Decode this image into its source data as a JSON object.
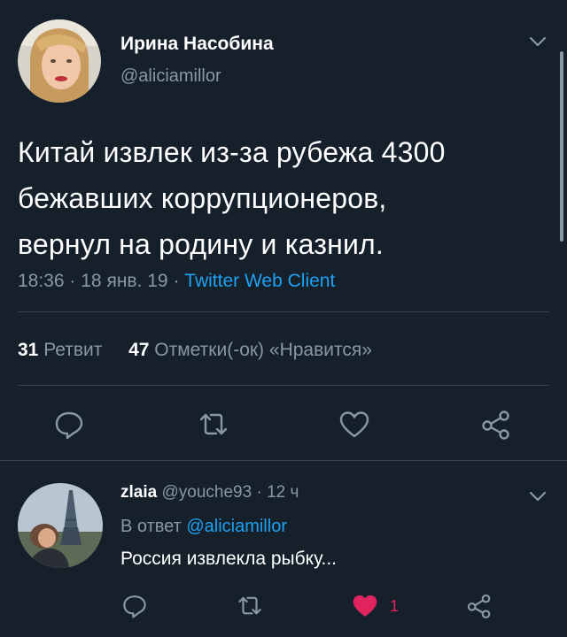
{
  "tweet": {
    "author_name": "Ирина Насобина",
    "author_handle": "@aliciamillor",
    "text_lines": [
      "Китай извлек из-за рубежа 4300",
      "бежавших коррупционеров,",
      "вернул на родину и казнил."
    ],
    "time": "18:36",
    "date": "18 янв. 19",
    "separator": "·",
    "client": "Twitter Web Client",
    "retweet_count": "31",
    "retweet_label": "Ретвит",
    "like_count": "47",
    "like_label": "Отметки(-ок) «Нравится»"
  },
  "reply": {
    "author_name": "zlaia",
    "author_handle": "@youche93",
    "separator": "·",
    "age": "12 ч",
    "reply_prefix": "В ответ",
    "reply_to": "@aliciamillor",
    "text": "Россия извлекла рыбку...",
    "like_count": "1",
    "liked": true
  },
  "icons": {
    "reply": "reply-icon",
    "retweet": "retweet-icon",
    "like": "heart-icon",
    "share": "share-icon",
    "menu": "chevron-down-icon"
  },
  "colors": {
    "background": "#15202b",
    "accent": "#1da1f2",
    "muted": "#8899a6",
    "like": "#e0245e"
  }
}
